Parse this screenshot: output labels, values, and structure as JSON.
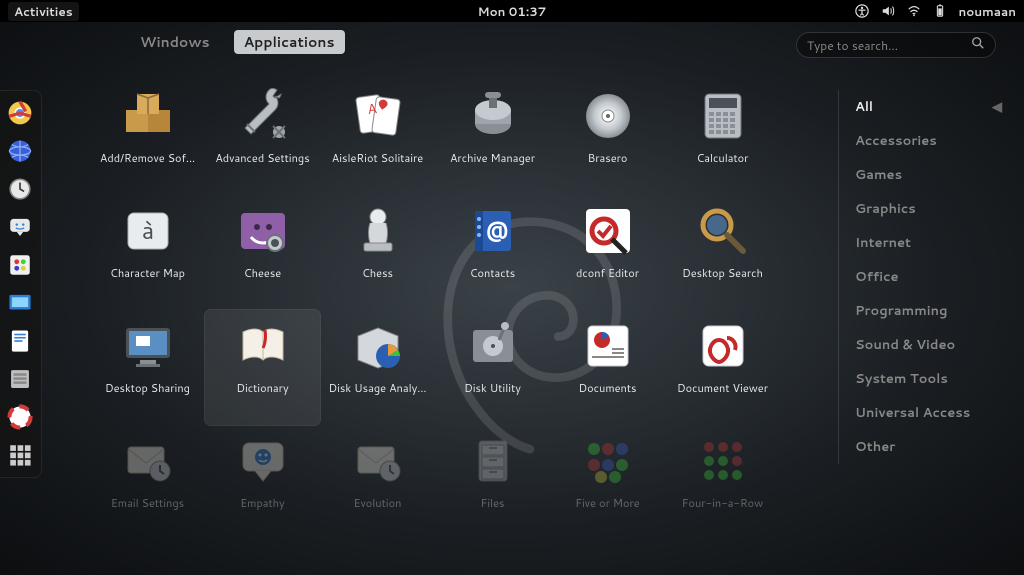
{
  "top_panel": {
    "activities": "Activities",
    "clock": "Mon 01:37",
    "username": "noumaan"
  },
  "tabs": {
    "windows": "Windows",
    "applications": "Applications"
  },
  "search": {
    "placeholder": "Type to search..."
  },
  "dash": [
    {
      "name": "chrome",
      "color": "#f4c84a"
    },
    {
      "name": "web-browser",
      "color": "#3a5fdd"
    },
    {
      "name": "clock",
      "color": "#cccccc"
    },
    {
      "name": "empathy",
      "color": "#e8e8e8"
    },
    {
      "name": "color-picker",
      "color": "#f0f0f0"
    },
    {
      "name": "screenshot",
      "color": "#2a7fd4"
    },
    {
      "name": "document",
      "color": "#3a7fd4"
    },
    {
      "name": "files",
      "color": "#bfbfbf"
    },
    {
      "name": "help",
      "color": "#d43a3a"
    },
    {
      "name": "show-apps",
      "color": "#888888"
    }
  ],
  "apps": [
    {
      "label": "Add/Remove Sof...",
      "icon": "packages",
      "bg": "#c89a4a"
    },
    {
      "label": "Advanced Settings",
      "icon": "wrench",
      "bg": "#7a8288"
    },
    {
      "label": "AisleRiot Solitaire",
      "icon": "cards",
      "bg": "#e8e8e8"
    },
    {
      "label": "Archive Manager",
      "icon": "roller",
      "bg": "#8a8f95"
    },
    {
      "label": "Brasero",
      "icon": "disc",
      "bg": "#b8bec4"
    },
    {
      "label": "Calculator",
      "icon": "calc",
      "bg": "#b8bec4"
    },
    {
      "label": "Character Map",
      "icon": "key-a",
      "bg": "#d4d8dc"
    },
    {
      "label": "Cheese",
      "icon": "cheese",
      "bg": "#8f5fa8"
    },
    {
      "label": "Chess",
      "icon": "chess",
      "bg": "#b8bec4"
    },
    {
      "label": "Contacts",
      "icon": "at",
      "bg": "#2a5fb4"
    },
    {
      "label": "dconf Editor",
      "icon": "dconf",
      "bg": "#ffffff"
    },
    {
      "label": "Desktop Search",
      "icon": "magnify",
      "bg": "#c89a4a"
    },
    {
      "label": "Desktop Sharing",
      "icon": "monitor",
      "bg": "#2a5fb4"
    },
    {
      "label": "Dictionary",
      "icon": "book",
      "bg": "#e8e8e8",
      "hovered": true
    },
    {
      "label": "Disk Usage Analy...",
      "icon": "pie",
      "bg": "#d4d8dc"
    },
    {
      "label": "Disk Utility",
      "icon": "disk",
      "bg": "#8a8f95"
    },
    {
      "label": "Documents",
      "icon": "docs",
      "bg": "#ffffff"
    },
    {
      "label": "Document Viewer",
      "icon": "evince",
      "bg": "#ffffff"
    },
    {
      "label": "Email Settings",
      "icon": "mail",
      "bg": "#d4d8dc",
      "faded": true
    },
    {
      "label": "Empathy",
      "icon": "smile",
      "bg": "#e8e8e8",
      "faded": true
    },
    {
      "label": "Evolution",
      "icon": "mail",
      "bg": "#d4d8dc",
      "faded": true
    },
    {
      "label": "Files",
      "icon": "cabinet",
      "bg": "#b8bec4",
      "faded": true
    },
    {
      "label": "Five or More",
      "icon": "balls",
      "bg": "#404040",
      "faded": true
    },
    {
      "label": "Four-in-a-Row",
      "icon": "balls2",
      "bg": "#404040",
      "faded": true
    }
  ],
  "categories": [
    {
      "label": "All",
      "active": true
    },
    {
      "label": "Accessories"
    },
    {
      "label": "Games"
    },
    {
      "label": "Graphics"
    },
    {
      "label": "Internet"
    },
    {
      "label": "Office"
    },
    {
      "label": "Programming"
    },
    {
      "label": "Sound & Video"
    },
    {
      "label": "System Tools"
    },
    {
      "label": "Universal Access"
    },
    {
      "label": "Other"
    }
  ]
}
